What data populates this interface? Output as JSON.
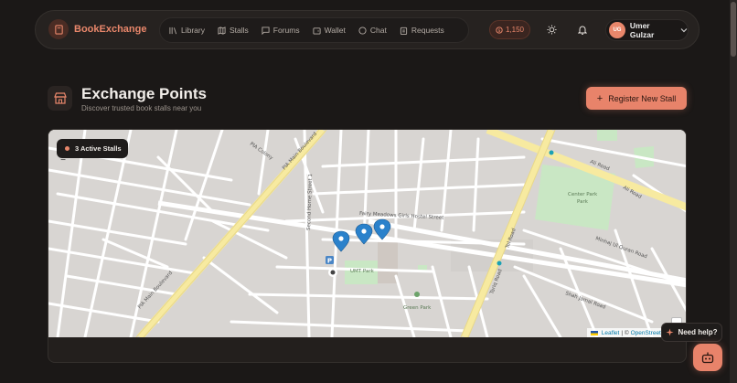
{
  "brand": {
    "name": "BookExchange",
    "icon": "book-icon"
  },
  "nav": {
    "items": [
      {
        "label": "Library",
        "icon": "library-icon"
      },
      {
        "label": "Stalls",
        "icon": "map-icon"
      },
      {
        "label": "Forums",
        "icon": "message-square-icon"
      },
      {
        "label": "Wallet",
        "icon": "wallet-icon"
      },
      {
        "label": "Chat",
        "icon": "chat-icon"
      },
      {
        "label": "Requests",
        "icon": "clipboard-icon"
      }
    ],
    "coins": "1,150",
    "user": {
      "initials": "UG",
      "name": "Umer Gulzar"
    }
  },
  "header": {
    "title": "Exchange Points",
    "subtitle": "Discover trusted book stalls near you",
    "register_label": "Register New Stall"
  },
  "map": {
    "active_badge": "3 Active Stalls",
    "zoom_out": "−",
    "labels": {
      "road_ali": "Ali Road",
      "road_ali2": "Ali Road",
      "center_park": "Center Park",
      "fairy": "Fairy Meadows Girls Hostel Street",
      "second_home": "Second Home Street 1",
      "pia_main": "PIA Main Boulevard",
      "pia_main2": "PIA Main Boulevard",
      "umt_park": "UMT Park",
      "green_park": "Green Park",
      "park_label": "Park",
      "pia_colony": "PIA Colony",
      "mehraj": "Minhaj Ul Quran Road",
      "shah_jamal": "Shah Jamal Road",
      "st_road": "Tel Road",
      "tall_road": "Tariq Road"
    },
    "attribution": {
      "leaflet": "Leaflet",
      "sep": "| ©",
      "osm": "OpenStreetMap",
      "rest": "con"
    }
  },
  "help": {
    "label": "Need help?"
  },
  "colors": {
    "accent": "#e8836a",
    "background": "#1b1817",
    "marker": "#2a81cb"
  }
}
